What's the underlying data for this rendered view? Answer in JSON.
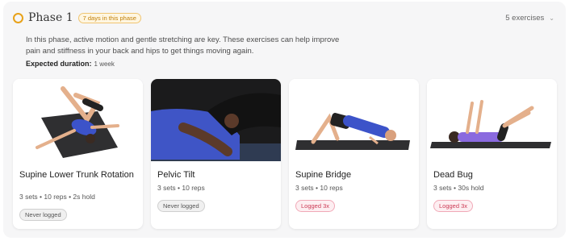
{
  "phase": {
    "title": "Phase 1",
    "days_badge": "7 days in this phase",
    "exercise_count": "5 exercises",
    "description": "In this phase, active motion and gentle stretching are key. These exercises can help improve pain and stiffness in your back and hips to get things moving again.",
    "expected_label": "Expected duration:",
    "expected_value": "1 week"
  },
  "cards": [
    {
      "name": "Supine Lower Trunk Rotation",
      "meta": "3 sets • 10 reps • 2s hold",
      "badge": "Never logged",
      "badge_style": "gray",
      "image": "supine-lower-trunk-rotation-photo"
    },
    {
      "name": "Pelvic Tilt",
      "meta": "3 sets • 10 reps",
      "badge": "Never logged",
      "badge_style": "gray",
      "image": "pelvic-tilt-photo"
    },
    {
      "name": "Supine Bridge",
      "meta": "3 sets • 10 reps",
      "badge": "Logged 3x",
      "badge_style": "red",
      "image": "supine-bridge-photo"
    },
    {
      "name": "Dead Bug",
      "meta": "3 sets • 30s hold",
      "badge": "Logged 3x",
      "badge_style": "red",
      "image": "dead-bug-photo"
    }
  ],
  "colors": {
    "accent": "#e8a21a",
    "logged": "#cc3b55"
  }
}
